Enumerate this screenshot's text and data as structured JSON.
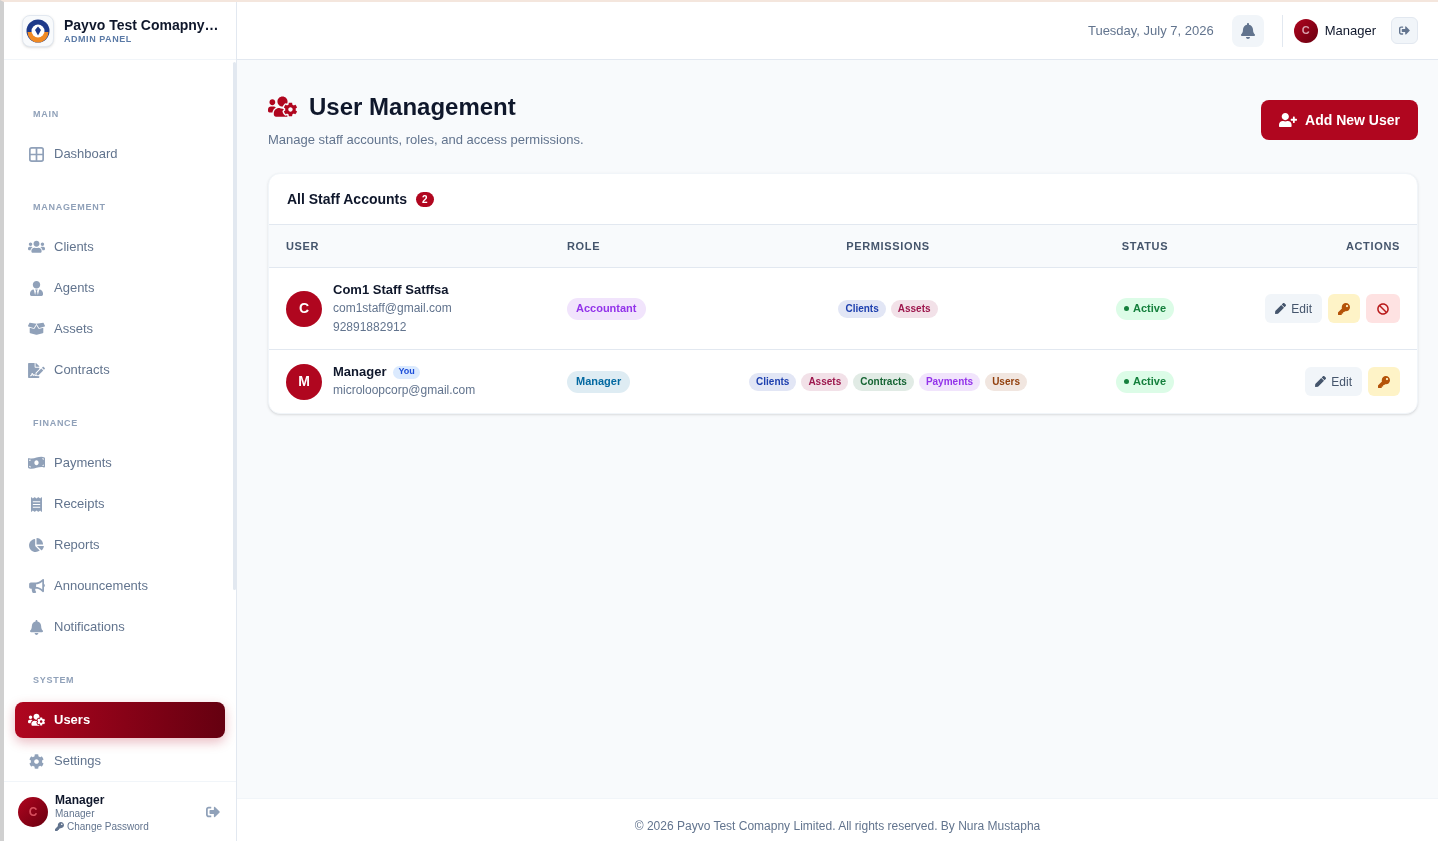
{
  "sidebar": {
    "brand": {
      "name": "Payvo Test Comapny…",
      "subtitle": "ADMIN PANEL"
    },
    "sections": [
      {
        "title": "MAIN",
        "items": [
          {
            "label": "Dashboard",
            "selected": false
          }
        ]
      },
      {
        "title": "MANAGEMENT",
        "items": [
          {
            "label": "Clients",
            "selected": false
          },
          {
            "label": "Agents",
            "selected": false
          },
          {
            "label": "Assets",
            "selected": false
          },
          {
            "label": "Contracts",
            "selected": false
          }
        ]
      },
      {
        "title": "FINANCE",
        "items": [
          {
            "label": "Payments",
            "selected": false
          },
          {
            "label": "Receipts",
            "selected": false
          },
          {
            "label": "Reports",
            "selected": false
          },
          {
            "label": "Announcements",
            "selected": false
          },
          {
            "label": "Notifications",
            "selected": false
          }
        ]
      },
      {
        "title": "SYSTEM",
        "items": [
          {
            "label": "Users",
            "selected": true
          },
          {
            "label": "Settings",
            "selected": false
          }
        ]
      }
    ],
    "user": {
      "avatar": "C",
      "name": "Manager",
      "role": "Manager",
      "link": "Change Password"
    }
  },
  "header": {
    "date": "Tuesday, July 7, 2026",
    "user": {
      "avatar": "C",
      "name": "Manager"
    }
  },
  "page": {
    "title": "User Management",
    "subtitle": "Manage staff accounts, roles, and access permissions.",
    "add_button": "Add New User"
  },
  "table": {
    "title": "All Staff Accounts",
    "count": "2",
    "columns": [
      "USER",
      "ROLE",
      "PERMISSIONS",
      "STATUS",
      "ACTIONS"
    ],
    "rows": [
      {
        "avatar": "C",
        "name": "Com1 Staff Satffsa",
        "email": "com1staff@gmail.com",
        "phone": "92891882912",
        "role": {
          "label": "Accountant",
          "color": "#9333ea"
        },
        "permissions": [
          {
            "label": "Clients",
            "color": "#1e40af"
          },
          {
            "label": "Assets",
            "color": "#9d174d"
          }
        ],
        "status": {
          "label": "Active",
          "kind": "active"
        },
        "actions": [
          {
            "kind": "edit",
            "label": "Edit"
          },
          {
            "kind": "key"
          },
          {
            "kind": "ban"
          }
        ]
      },
      {
        "avatar": "M",
        "name": "Manager",
        "badge": "You",
        "email": "microloopcorp@gmail.com",
        "role": {
          "label": "Manager",
          "color": "#0369a1"
        },
        "permissions": [
          {
            "label": "Clients",
            "color": "#1e40af"
          },
          {
            "label": "Assets",
            "color": "#9d174d"
          },
          {
            "label": "Contracts",
            "color": "#166534"
          },
          {
            "label": "Payments",
            "color": "#9333ea"
          },
          {
            "label": "Users",
            "color": "#92400e"
          }
        ],
        "status": {
          "label": "Active",
          "kind": "active"
        },
        "actions": [
          {
            "kind": "edit",
            "label": "Edit"
          },
          {
            "kind": "key"
          }
        ]
      }
    ]
  },
  "footer": "© 2026 Payvo Test Comapny Limited. All rights reserved. By Nura Mustapha"
}
